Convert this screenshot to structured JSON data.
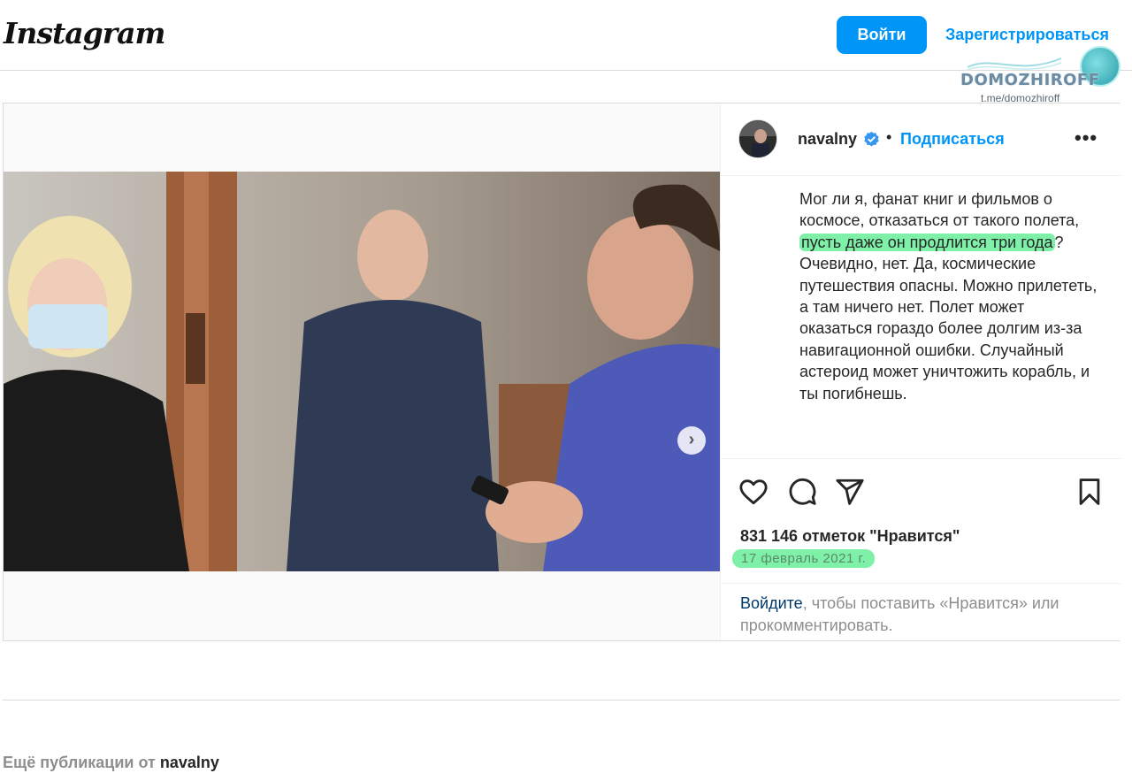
{
  "header": {
    "logo": "Instagram",
    "login_label": "Войти",
    "signup_label": "Зарегистрироваться"
  },
  "watermark": {
    "name": "DOMOZHIROFF",
    "link": "t.me/domozhiroff"
  },
  "post": {
    "carousel": {
      "total_slides": 2,
      "active_slide": 1
    },
    "author": {
      "username": "navalny",
      "verified": true,
      "follow_label": "Подписаться",
      "separator": "•"
    },
    "caption": {
      "part1": "Мог ли я, фанат книг и фильмов о космосе, отказаться от такого полета, ",
      "highlight": "пусть даже он продлится три года",
      "part2": "? Очевидно, нет. Да, космические путешествия опасны. Можно прилететь, а там ничего нет. Полет может оказаться гораздо более долгим из-за навигационной ошибки. Случайный астероид может уничтожить корабль, и ты погибнешь."
    },
    "actions": [
      "heart-icon",
      "comment-icon",
      "share-icon",
      "bookmark-icon"
    ],
    "likes": "831 146 отметок \"Нравится\"",
    "date": "17 февраль 2021 г.",
    "comment_prompt": {
      "login": "Войдите",
      "rest": ", чтобы поставить «Нравится» или прокомментировать."
    }
  },
  "more_publications": {
    "prefix": "Ещё публикации от ",
    "username": "navalny"
  },
  "colors": {
    "accent": "#0095f6",
    "highlight": "#7ef0a8",
    "border": "#dbdbdb",
    "text": "#262626",
    "muted": "#8e8e8e"
  }
}
